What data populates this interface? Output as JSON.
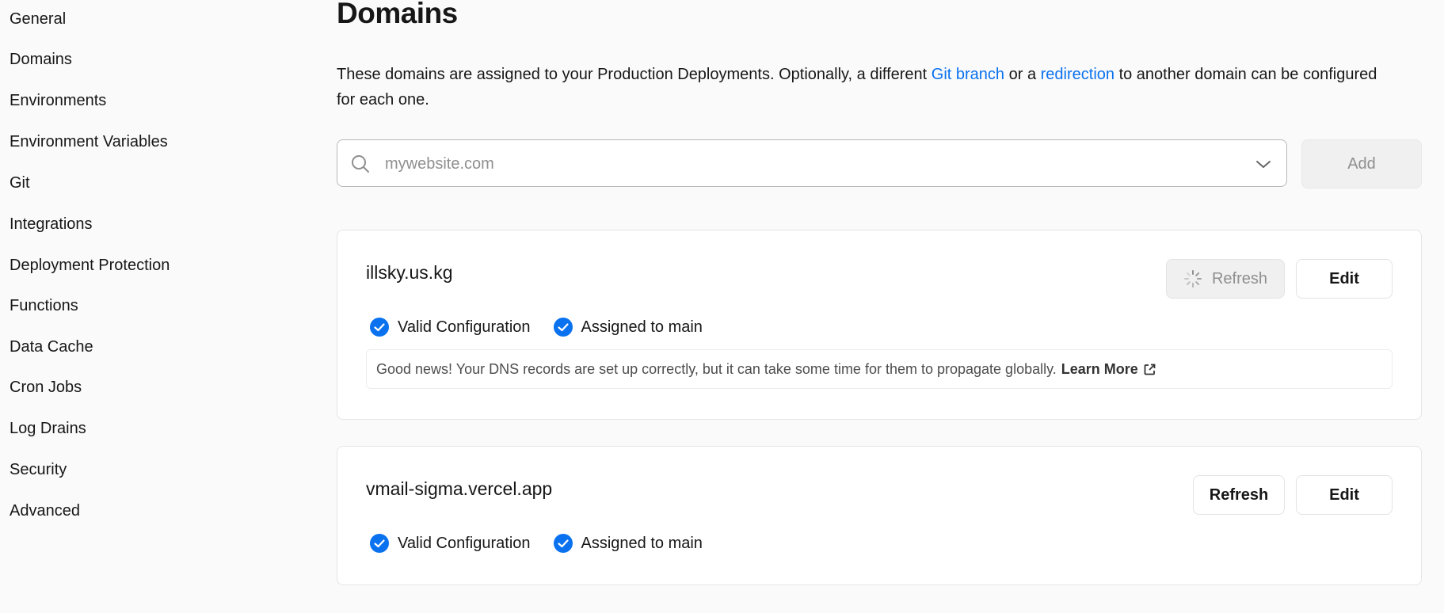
{
  "sidebar": {
    "items": [
      {
        "label": "General"
      },
      {
        "label": "Domains"
      },
      {
        "label": "Environments"
      },
      {
        "label": "Environment Variables"
      },
      {
        "label": "Git"
      },
      {
        "label": "Integrations"
      },
      {
        "label": "Deployment Protection"
      },
      {
        "label": "Functions"
      },
      {
        "label": "Data Cache"
      },
      {
        "label": "Cron Jobs"
      },
      {
        "label": "Log Drains"
      },
      {
        "label": "Security"
      },
      {
        "label": "Advanced"
      }
    ]
  },
  "main": {
    "title": "Domains",
    "intro": {
      "part1": "These domains are assigned to your Production Deployments. Optionally, a different ",
      "link1": "Git branch",
      "part2": " or a ",
      "link2": "redirection",
      "part3": " to another domain can be configured for each one."
    },
    "search": {
      "placeholder": "mywebsite.com",
      "value": ""
    },
    "add_label": "Add",
    "domains": [
      {
        "name": "illsky.us.kg",
        "refresh_label": "Refresh",
        "refresh_state": "loading",
        "edit_label": "Edit",
        "statuses": [
          "Valid Configuration",
          "Assigned to main"
        ],
        "notice": "Good news! Your DNS records are set up correctly, but it can take some time for them to propagate globally.",
        "learn_more": "Learn More"
      },
      {
        "name": "vmail-sigma.vercel.app",
        "refresh_label": "Refresh",
        "refresh_state": "idle",
        "edit_label": "Edit",
        "statuses": [
          "Valid Configuration",
          "Assigned to main"
        ]
      }
    ]
  },
  "colors": {
    "link": "#0a72ef",
    "check": "#0a72ef",
    "text": "#171717",
    "muted": "#8f8f8f"
  },
  "icons": [
    "search-icon",
    "chevron-down-icon",
    "spinner-icon",
    "check-circle-icon",
    "external-link-icon"
  ]
}
